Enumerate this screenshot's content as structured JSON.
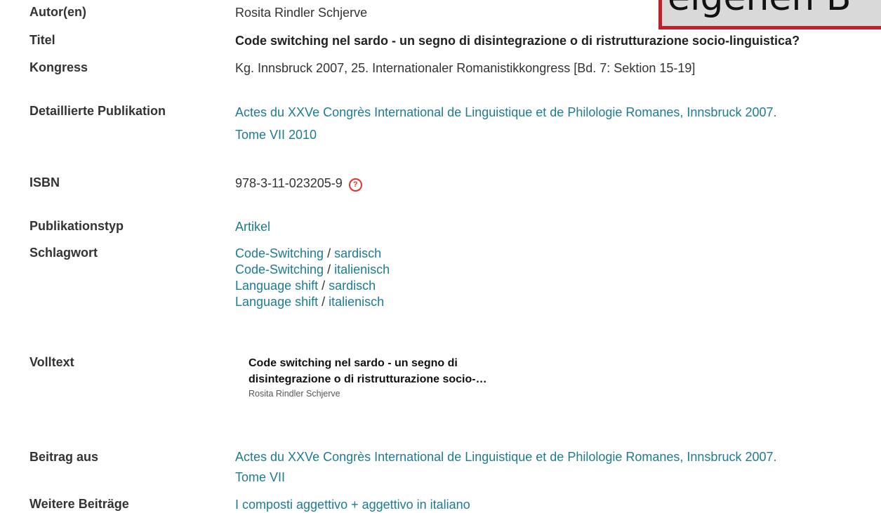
{
  "overlay": {
    "text": "eigenen B"
  },
  "rows": {
    "autor": {
      "label": "Autor(en)",
      "value": "Rosita Rindler Schjerve"
    },
    "titel": {
      "label": "Titel",
      "value": "Code switching nel sardo - un segno di disintegrazione o di ristrutturazione socio-linguistica?"
    },
    "kongress": {
      "label": "Kongress",
      "value": "Kg. Innsbruck 2007, 25. Internationaler Romanistikkongress [Bd. 7: Sektion 15-19]"
    },
    "detail": {
      "label": "Detaillierte Publikation",
      "line1": "Actes du XXVe Congrès International de Linguistique et de Philologie Romanes, Innsbruck 2007.",
      "line2": "Tome VII 2010"
    },
    "isbn": {
      "label": "ISBN",
      "value": "978-3-11-023205-9",
      "icon": "help-icon"
    },
    "typ": {
      "label": "Publikationstyp",
      "value": "Artikel"
    },
    "schlagwort": {
      "label": "Schlagwort",
      "items": [
        {
          "term": "Code-Switching",
          "sep": " / ",
          "qualifier": "sardisch"
        },
        {
          "term": "Code-Switching",
          "sep": " / ",
          "qualifier": "italienisch"
        },
        {
          "term": "Language shift",
          "sep": " / ",
          "qualifier": "sardisch"
        },
        {
          "term": "Language shift",
          "sep": " / ",
          "qualifier": "italienisch"
        }
      ]
    },
    "volltext": {
      "label": "Volltext",
      "title_line1": "Code switching nel sardo - un segno di",
      "title_line2": "disintegrazione o di ristrutturazione socio-…",
      "author": "Rosita Rindler Schjerve"
    },
    "beitrag": {
      "label": "Beitrag aus",
      "line1": "Actes du XXVe Congrès International de Linguistique et de Philologie Romanes, Innsbruck 2007.",
      "line2": "Tome VII"
    },
    "weitere": {
      "label": "Weitere Beiträge",
      "value": "I composti aggettivo + aggettivo in italiano"
    }
  },
  "colors": {
    "link": "#1e7b91",
    "label": "#333333",
    "accent": "#e0332b",
    "overlay_border": "#c0202a"
  }
}
